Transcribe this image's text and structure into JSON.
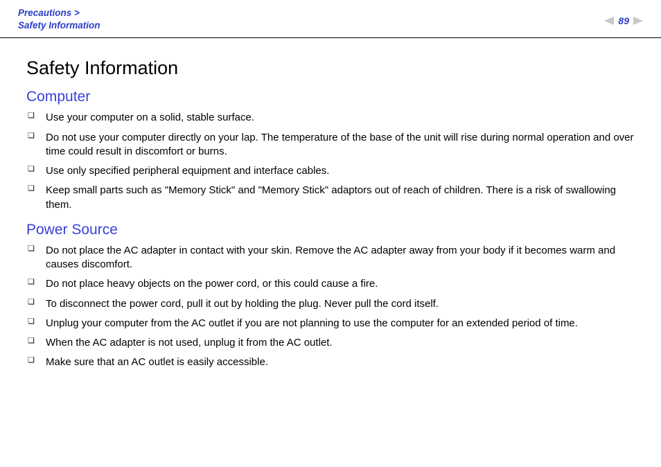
{
  "header": {
    "breadcrumb_parent": "Precautions >",
    "breadcrumb_current": "Safety Information",
    "page_number": "89"
  },
  "main": {
    "title": "Safety Information",
    "sections": [
      {
        "heading": "Computer",
        "items": [
          "Use your computer on a solid, stable surface.",
          "Do not use your computer directly on your lap. The temperature of the base of the unit will rise during normal operation and over time could result in discomfort or burns.",
          "Use only specified peripheral equipment and interface cables.",
          "Keep small parts such as \"Memory Stick\" and \"Memory Stick\" adaptors out of reach of children. There is a risk of swallowing them."
        ]
      },
      {
        "heading": "Power Source",
        "items": [
          "Do not place the AC adapter in contact with your skin. Remove the AC adapter away from your body if it becomes warm and causes discomfort.",
          "Do not place heavy objects on the power cord, or this could cause a fire.",
          "To disconnect the power cord, pull it out by holding the plug. Never pull the cord itself.",
          "Unplug your computer from the AC outlet if you are not planning to use the computer for an extended period of time.",
          "When the AC adapter is not used, unplug it from the AC outlet.",
          "Make sure that an AC outlet is easily accessible."
        ]
      }
    ]
  }
}
